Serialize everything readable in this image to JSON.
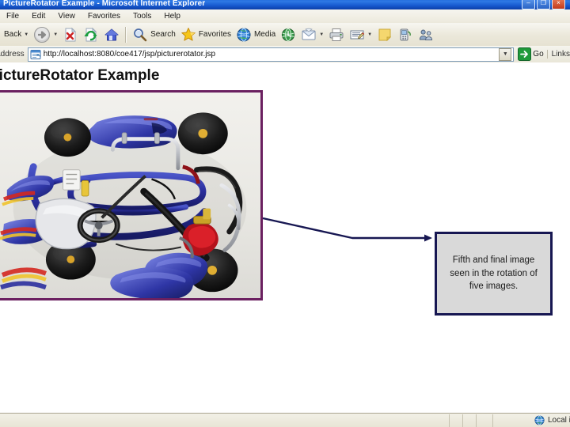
{
  "window": {
    "title": "PictureRotator Example - Microsoft Internet Explorer",
    "controls": {
      "minimize": "–",
      "maximize": "❐",
      "close": "×"
    }
  },
  "menu": {
    "items": [
      {
        "label": "File"
      },
      {
        "label": "Edit"
      },
      {
        "label": "View"
      },
      {
        "label": "Favorites"
      },
      {
        "label": "Tools"
      },
      {
        "label": "Help"
      }
    ]
  },
  "toolbar": {
    "back_label": "Back",
    "forward_label": "",
    "stop_label": "",
    "refresh_label": "",
    "home_label": "",
    "search_label": "Search",
    "favorites_label": "Favorites",
    "media_label": "Media",
    "history_label": "",
    "mail_label": "",
    "print_label": "",
    "edit_label": "",
    "notes_label": "",
    "messenger_label": "",
    "discuss_label": "",
    "icons": {
      "back": "back-arrow-icon",
      "forward": "forward-arrow-icon",
      "stop": "stop-icon",
      "refresh": "refresh-icon",
      "home": "home-icon",
      "search": "search-icon",
      "favorites": "star-icon",
      "media": "media-globe-icon",
      "history": "history-globe-icon",
      "mail": "mail-icon",
      "print": "printer-icon",
      "edit": "edit-page-icon",
      "notes": "notes-icon",
      "messenger": "messenger-icon",
      "discuss": "discuss-people-icon"
    }
  },
  "address": {
    "label": "Address",
    "url": "http://localhost:8080/coe417/jsp/picturerotator.jsp",
    "placeholder": "",
    "go_label": "Go",
    "links_label": "Links"
  },
  "page": {
    "heading": "PictureRotator Example",
    "photo": {
      "alt": "Blue go-kart chassis photographed from above",
      "border_color": "#6b2060"
    },
    "callout": {
      "text": "Fifth and final image seen in the rotation of five images.",
      "border_color": "#171752",
      "fill_color": "#d9d9d9"
    },
    "arrow": {
      "color": "#171752"
    }
  },
  "status": {
    "message": "",
    "zone": "Local intranet"
  }
}
